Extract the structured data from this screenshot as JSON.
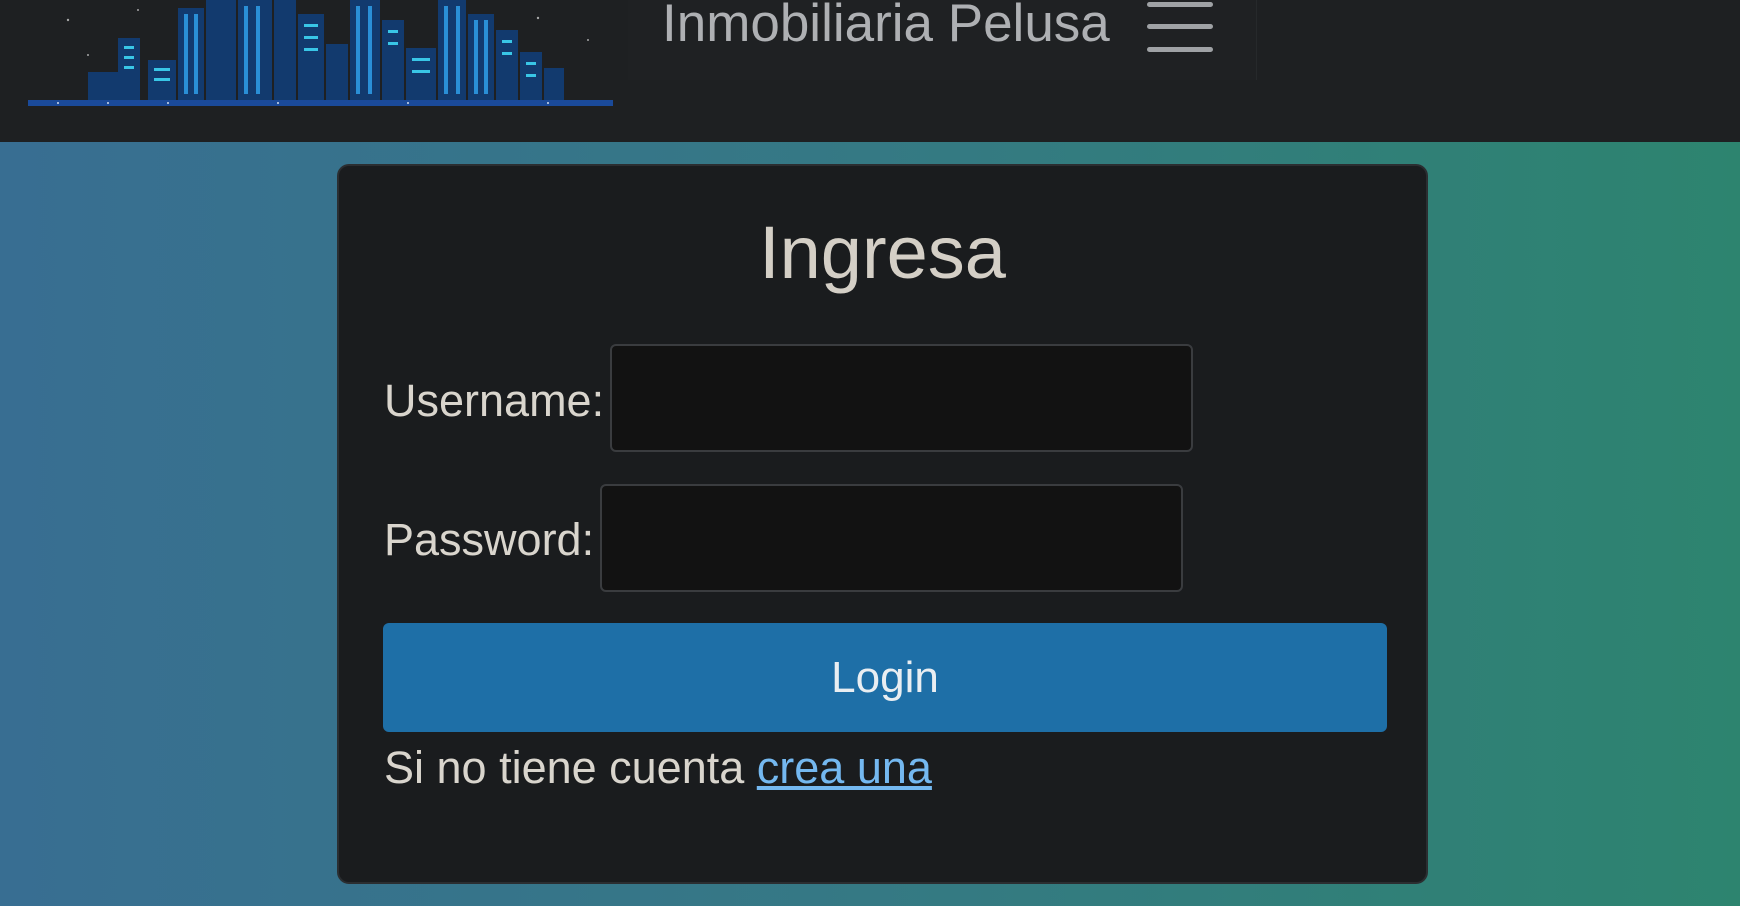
{
  "header": {
    "brand": "Inmobiliaria Pelusa",
    "logo_icon": "city-skyline-logo",
    "menu_icon": "hamburger-menu-icon"
  },
  "login_form": {
    "title": "Ingresa",
    "username_label": "Username:",
    "username_value": "",
    "password_label": "Password:",
    "password_value": "",
    "submit_label": "Login",
    "signup_prompt": "Si no tiene cuenta",
    "signup_link": "crea una"
  },
  "colors": {
    "navbar": "#1e2022",
    "card": "#1a1c1e",
    "button": "#1e6fa7",
    "link": "#74b8f0",
    "background_start": "#386e92",
    "background_end": "#2d846f"
  }
}
